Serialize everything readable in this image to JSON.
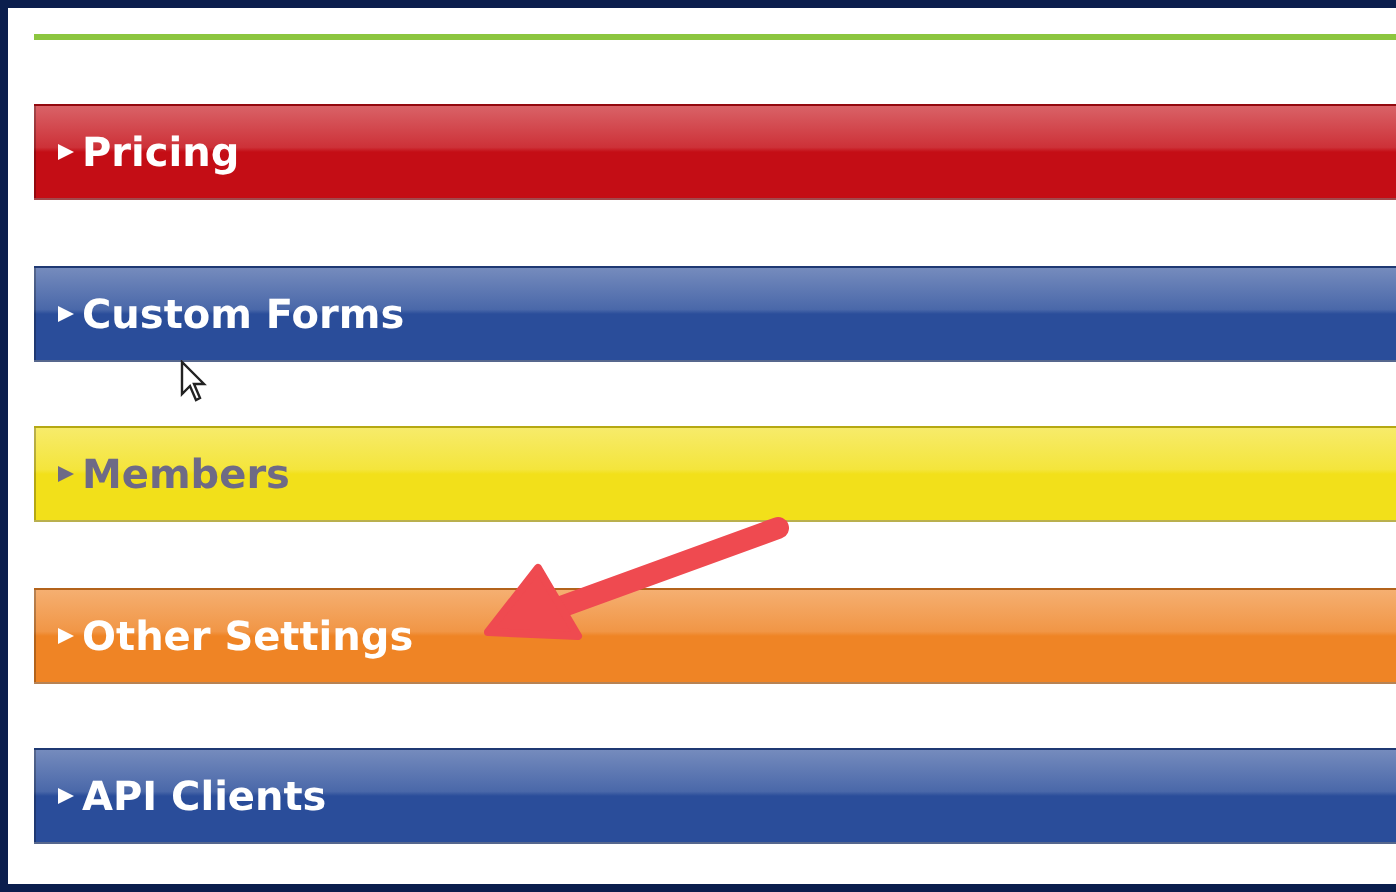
{
  "sections": [
    {
      "label": "Pricing",
      "color": "#c40d15",
      "expanded": false
    },
    {
      "label": "Custom Forms",
      "color": "#2a4d9a",
      "expanded": false
    },
    {
      "label": "Members",
      "color": "#f2e01a",
      "expanded": false
    },
    {
      "label": "Other Settings",
      "color": "#ef8425",
      "expanded": false
    },
    {
      "label": "API Clients",
      "color": "#2a4d9a",
      "expanded": false
    }
  ]
}
